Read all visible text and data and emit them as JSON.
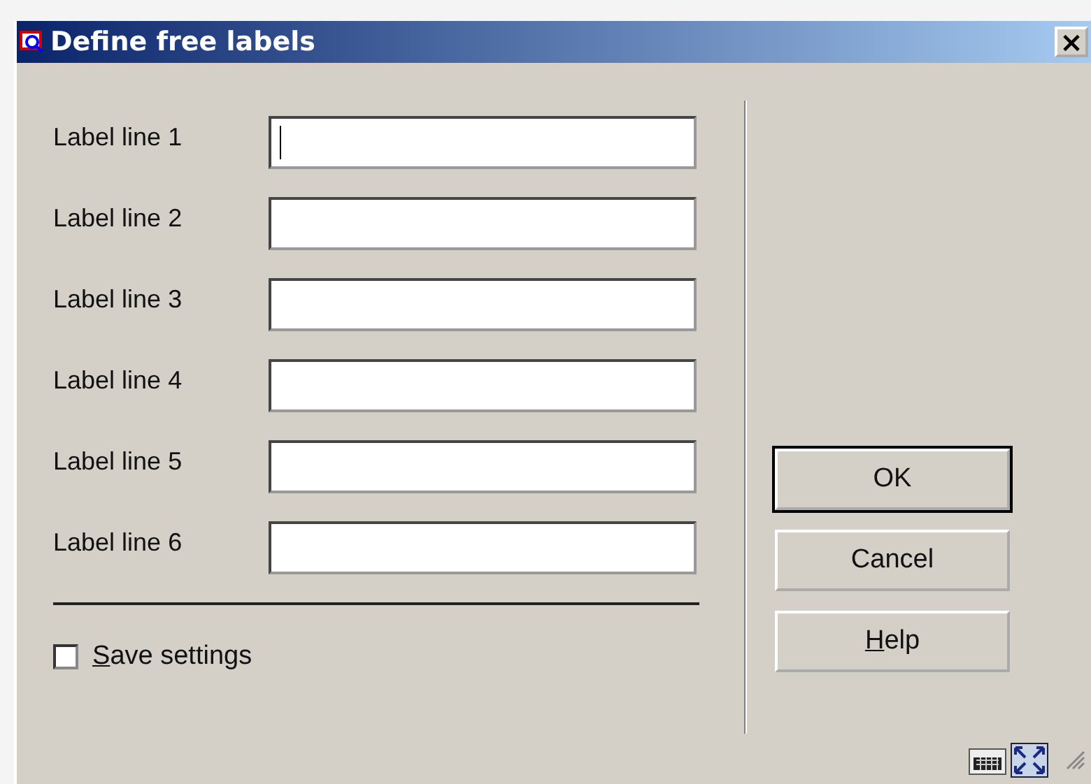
{
  "window": {
    "title": "Define free labels",
    "close": "×"
  },
  "fields": [
    {
      "label": "Label line 1",
      "focused": true
    },
    {
      "label": "Label line 2",
      "focused": false
    },
    {
      "label": "Label line 3",
      "focused": false
    },
    {
      "label": "Label line 4",
      "focused": false
    },
    {
      "label": "Label line 5",
      "focused": false
    },
    {
      "label": "Label line 6",
      "focused": false
    }
  ],
  "save_settings": {
    "label": "Save settings",
    "checked": false,
    "mnemonic_first_letter": true
  },
  "buttons": [
    {
      "label": "OK",
      "default": true,
      "mnemonic_first_letter": false
    },
    {
      "label": "Cancel",
      "default": false,
      "mnemonic_first_letter": false
    },
    {
      "label": "Help",
      "default": false,
      "mnemonic_first_letter": true
    }
  ]
}
